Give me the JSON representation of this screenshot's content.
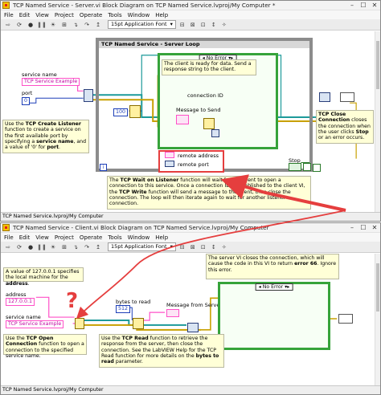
{
  "window1": {
    "title": "TCP Named Service - Server.vi Block Diagram on TCP Named Service.lvproj/My Computer *",
    "menus": [
      "File",
      "Edit",
      "View",
      "Project",
      "Operate",
      "Tools",
      "Window",
      "Help"
    ],
    "font": "15pt Application Font",
    "status": "TCP Named Service.lvproj/My Computer",
    "loop_title": "TCP Named Service - Server Loop",
    "case_selector": "No Error",
    "case_note": "The client is ready for data. Send a response string to the client.",
    "labels": {
      "service_name": "service name",
      "port": "port",
      "connection_id": "connection ID",
      "message_to_send": "Message to Send",
      "remote_address": "remote address",
      "remote_port": "remote port",
      "stop": "Stop"
    },
    "constants": {
      "service_name": "TCP Service Example",
      "port": "0",
      "timeout": "100"
    },
    "iteration": "i",
    "note_create_listener": {
      "pre": "Use the ",
      "bold1": "TCP Create Listener",
      "mid1": " function to create a service on the first available port by specifying a ",
      "bold2": "service name",
      "mid2": ", and a value of '0' for ",
      "bold3": "port",
      "post": "."
    },
    "note_close": {
      "bold1": "TCP Close Connection",
      "mid1": " closes the connection when the user clicks ",
      "bold2": "Stop",
      "post": " or an error occurs."
    },
    "note_wait": {
      "pre": "The ",
      "bold1": "TCP Wait on Listener",
      "mid1": " function will wait for the client to open a connection to this service. Once a connection ID is established to the client VI, the ",
      "bold2": "TCP Write",
      "post": " function will send a message to the client, then close the connection. The loop will then iterate again to wait for another listener connection."
    }
  },
  "window2": {
    "title": "TCP Named Service - Client.vi Block Diagram on TCP Named Service.lvproj/My Computer",
    "menus": [
      "File",
      "Edit",
      "View",
      "Project",
      "Operate",
      "Tools",
      "Window",
      "Help"
    ],
    "font": "15pt Application Font",
    "status": "TCP Named Service.lvproj/My Computer",
    "case_selector": "No Error",
    "labels": {
      "address": "address",
      "service_name": "service name",
      "bytes_to_read": "bytes to read",
      "message_from_server": "Message from Server"
    },
    "constants": {
      "address": "127.0.0.1",
      "service_name": "TCP Service Example",
      "bytes_to_read": "512"
    },
    "note_localhost": {
      "pre": "A value of 127.0.0.1 specifies the local machine for the ",
      "bold1": "address",
      "post": "."
    },
    "note_server_closes": {
      "pre": "The server VI closes the connection, which will cause the code in this VI to return ",
      "bold1": "error 66",
      "post": ". Ignore this error."
    },
    "note_open": {
      "pre": "Use the ",
      "bold1": "TCP Open Connection",
      "post": " function to open a connection to the specified service name."
    },
    "note_read": {
      "pre": "Use the ",
      "bold1": "TCP Read",
      "mid1": " function to retrieve the response from the server, then close the connection. See the LabVIEW Help for the TCP Read function for more details on the ",
      "bold2": "bytes to read",
      "post": " parameter."
    }
  },
  "annotation": {
    "question_mark": "?"
  },
  "colors": {
    "string_wire": "#ff50c8",
    "error_wire": "#c8a000",
    "refnum_wire": "#1d9a9a",
    "arrow": "#e53e3e",
    "loop_border": "#8c8c8c",
    "case_border": "#36a33a"
  }
}
